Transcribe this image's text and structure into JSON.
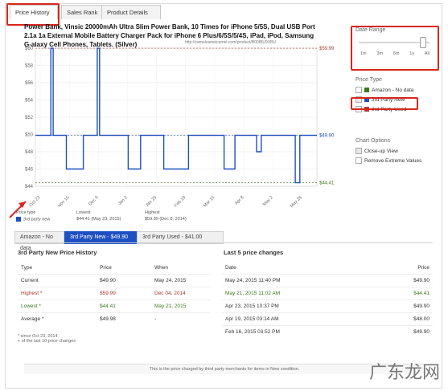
{
  "tabs": [
    {
      "label": "Price History",
      "active": true
    },
    {
      "label": "Sales Rank",
      "active": false
    },
    {
      "label": "Product Details",
      "active": false
    }
  ],
  "product": {
    "title": "Power Bank, Vinsic 20000mAh Ultra Slim Power Bank, 10 Times for iPhone 5/5S, Dual USB Port 2.1a 1a External Mobile Battery Charger Pack for iPhone 6 Plus/6/5S/5/4S, iPad, iPod, Samsung G-alaxy Cell Phones, Tablets. (Silver)",
    "url": "http://camelcamelcamel.com/product/B00IBU9XBU"
  },
  "right_panel": {
    "date_range": {
      "title": "Date Range",
      "options": [
        "1m",
        "3m",
        "6m",
        "1y",
        "All"
      ],
      "selected": "All"
    },
    "price_type": {
      "title": "Price Type",
      "items": [
        {
          "label": "Amazon - No data",
          "checked": false,
          "color": "#3a7a1d"
        },
        {
          "label": "3rd Party New",
          "checked": true,
          "color": "#1e4fc2"
        },
        {
          "label": "3rd Party Used",
          "checked": false,
          "color": "#b03a2e"
        }
      ]
    },
    "chart_options": {
      "title": "Chart Options",
      "items": [
        {
          "label": "Close-up View",
          "checked": true
        },
        {
          "label": "Remove Extreme Values",
          "checked": false
        }
      ]
    }
  },
  "chart_data": {
    "type": "line",
    "title": "",
    "xlabel": "",
    "ylabel": "",
    "y_ticks": [
      "$60",
      "$58",
      "$56",
      "$54",
      "$52",
      "$50",
      "$48",
      "$46",
      "$44"
    ],
    "ylim": [
      44,
      60
    ],
    "x_tick_labels": [
      "Oct 23",
      "Nov 15",
      "Dec 9",
      "Jan 2",
      "Jan 26",
      "Feb 19",
      "Mar 15",
      "Apr 8",
      "May 2",
      "May 26"
    ],
    "series": [
      {
        "name": "3rd party new",
        "color": "#1e4fc2",
        "points": [
          [
            0,
            49.9
          ],
          [
            1.0,
            49.9
          ],
          [
            1.0,
            59.99
          ],
          [
            1.15,
            59.99
          ],
          [
            1.15,
            49.9
          ],
          [
            2.0,
            49.9
          ],
          [
            2.0,
            46.0
          ],
          [
            3.1,
            46.0
          ],
          [
            3.1,
            49.9
          ],
          [
            4.0,
            49.9
          ],
          [
            4.0,
            59.99
          ],
          [
            4.15,
            59.99
          ],
          [
            4.15,
            49.9
          ],
          [
            6.0,
            49.9
          ],
          [
            6.0,
            46.0
          ],
          [
            6.8,
            46.0
          ],
          [
            6.8,
            49.9
          ],
          [
            8.3,
            49.9
          ],
          [
            8.3,
            46.0
          ],
          [
            9.9,
            46.0
          ],
          [
            9.9,
            49.9
          ],
          [
            12.2,
            49.9
          ],
          [
            12.2,
            46.0
          ],
          [
            12.9,
            46.0
          ],
          [
            12.9,
            49.9
          ],
          [
            14.3,
            49.9
          ],
          [
            14.3,
            48.0
          ],
          [
            14.6,
            48.0
          ],
          [
            14.6,
            49.9
          ],
          [
            16.8,
            49.9
          ],
          [
            16.8,
            44.41
          ],
          [
            17.1,
            44.41
          ],
          [
            17.1,
            49.9
          ],
          [
            18.2,
            49.9
          ]
        ]
      }
    ],
    "annotations": [
      {
        "label": "$59.99",
        "y": 59.99,
        "color": "#b03a2e"
      },
      {
        "label": "$49.90",
        "y": 49.9,
        "color": "#1e4fc2"
      },
      {
        "label": "$44.41",
        "y": 44.41,
        "color": "#3a7a1d"
      }
    ],
    "legend": {
      "label": "3rd party new",
      "color": "#1e4fc2"
    },
    "summary": {
      "price_type": "Price type",
      "lowest": "Lowest",
      "lowest_val": "$44.41 (May 23, 2015)",
      "highest": "Highest",
      "highest_val": "$59.99 (Dec 8, 2014)"
    }
  },
  "price_tabs": [
    {
      "label": "Amazon - No data",
      "active": false
    },
    {
      "label": "3rd Party New - $49.90",
      "active": true
    },
    {
      "label": "3rd Party Used - $41.00",
      "active": false
    }
  ],
  "history": {
    "title": "3rd Party New Price History",
    "headers": [
      "Type",
      "Price",
      "When"
    ],
    "rows": [
      {
        "type": "Current",
        "price": "$49.90",
        "when": "May 24, 2015",
        "color": "#333"
      },
      {
        "type": "Highest *",
        "price": "$59.99",
        "when": "Dec 04, 2014",
        "color": "#b03a2e"
      },
      {
        "type": "Lowest *",
        "price": "$44.41",
        "when": "May 21, 2015",
        "color": "#3a7a1d"
      },
      {
        "type": "Average *",
        "price": "$49.98",
        "when": "-",
        "color": "#333"
      }
    ],
    "footnotes": [
      "* since Oct 23, 2014",
      "+ of the last 10 price changes"
    ]
  },
  "last5": {
    "title": "Last 5 price changes",
    "headers": [
      "Date",
      "Price"
    ],
    "rows": [
      {
        "date": "May 24, 2015 11:40 PM",
        "price": "$49.90",
        "color": "#333"
      },
      {
        "date": "May 21, 2015 11:02 AM",
        "price": "$44.41",
        "color": "#3a7a1d"
      },
      {
        "date": "Apr 23, 2015 10:37 PM",
        "price": "$49.90",
        "color": "#333"
      },
      {
        "date": "Apr 19, 2015 03:14 AM",
        "price": "$48.00",
        "color": "#333"
      },
      {
        "date": "Feb 16, 2015 03:52 PM",
        "price": "$49.90",
        "color": "#333"
      }
    ]
  },
  "footer_note": "This is the price charged by third party merchants for items in New condition.",
  "watermark": "广东龙网"
}
